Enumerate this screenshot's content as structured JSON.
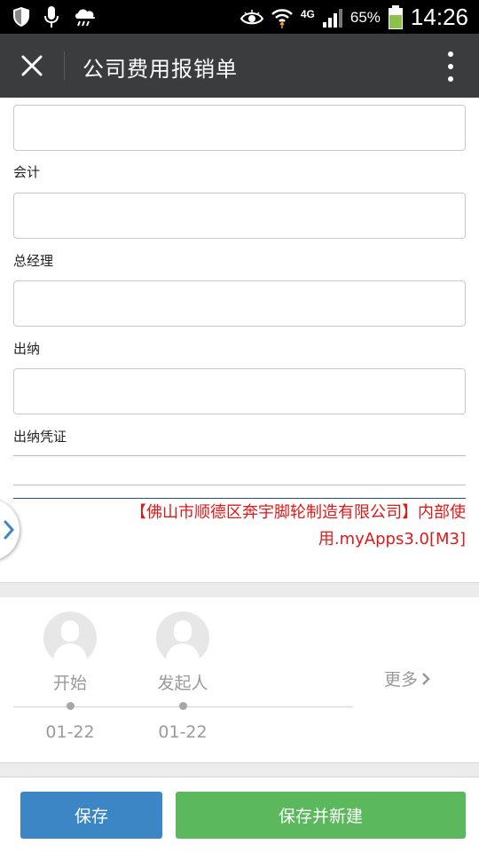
{
  "statusbar": {
    "battery": "65%",
    "network": "4G",
    "time": "14:26"
  },
  "header": {
    "title": "公司费用报销单"
  },
  "form": {
    "fields": [
      {
        "label": "会计",
        "value": ""
      },
      {
        "label": "总经理",
        "value": ""
      },
      {
        "label": "出纳",
        "value": ""
      },
      {
        "label": "出纳凭证",
        "value": ""
      }
    ],
    "top_input_value": ""
  },
  "footer_note": {
    "line1": "【佛山市顺德区奔宇脚轮制造有限公司】内部使",
    "line2": "用.myApps3.0[M3]"
  },
  "flow": {
    "nodes": [
      {
        "label": "开始",
        "date": "01-22"
      },
      {
        "label": "发起人",
        "date": "01-22"
      }
    ],
    "more_label": "更多"
  },
  "actions": {
    "save_label": "保存",
    "save_new_label": "保存并新建"
  },
  "colors": {
    "navbar": "#3b3c3e",
    "save_button": "#3d86c6",
    "save_new_button": "#5cb85c",
    "note_text": "#e01818"
  }
}
